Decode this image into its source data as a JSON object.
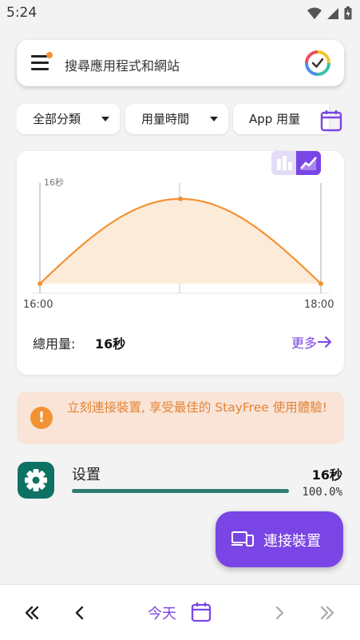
{
  "status_bar": {
    "time": "5:24"
  },
  "search": {
    "placeholder": "搜尋應用程式和網站"
  },
  "filters": {
    "category": "全部分類",
    "metric": "用量時間",
    "sort": "App 用量"
  },
  "chart_data": {
    "type": "area",
    "x_labels": [
      "16:00",
      "18:00"
    ],
    "y_max_label": "16秒",
    "x": [
      0,
      0.5,
      1
    ],
    "values": [
      0,
      16,
      0
    ],
    "ylim": [
      0,
      19
    ],
    "grid": true,
    "colors": {
      "line": "#f39233",
      "fill": "#fdebd9"
    }
  },
  "summary": {
    "label": "總用量:",
    "value": "16秒",
    "more": "更多"
  },
  "banner": {
    "text": "立刻連接裝置, 享受最佳的 StayFree 使用體驗!"
  },
  "apps": [
    {
      "name": "设置",
      "time": "16秒",
      "percent": "100.0%",
      "share": 1.0
    }
  ],
  "fab": {
    "label": "連接裝置"
  },
  "bottom_nav": {
    "today": "今天"
  },
  "colors": {
    "accent": "#7a45e5",
    "warning": "#f39233",
    "settings_icon": "#0d7263"
  }
}
